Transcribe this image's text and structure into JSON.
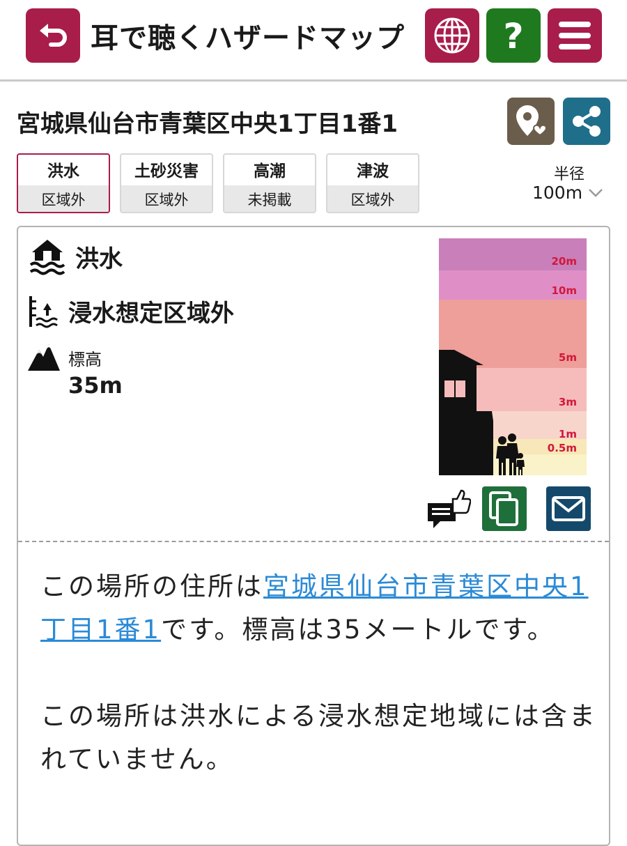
{
  "header": {
    "title": "耳で聴くハザードマップ"
  },
  "location": {
    "address": "宮城県仙台市青葉区中央1丁目1番1"
  },
  "tabs": [
    {
      "label": "洪水",
      "status": "区域外",
      "active": true
    },
    {
      "label": "土砂災害",
      "status": "区域外",
      "active": false
    },
    {
      "label": "高潮",
      "status": "未掲載",
      "active": false
    },
    {
      "label": "津波",
      "status": "区域外",
      "active": false
    }
  ],
  "radius": {
    "label": "半径",
    "value": "100m"
  },
  "detail": {
    "hazard_title": "洪水",
    "status": "浸水想定区域外",
    "elevation_label": "標高",
    "elevation_value": "35m"
  },
  "depth_scale": {
    "levels": [
      "20m",
      "10m",
      "5m",
      "3m",
      "1m",
      "0.5m"
    ]
  },
  "description": {
    "p1_prefix": "この場所の住所は",
    "p1_link": "宮城県仙台市青葉区中央1丁目1番1",
    "p1_suffix": "です。標高は35メートルです。",
    "p2": "この場所は洪水による浸水想定地域には含まれていません。"
  },
  "colors": {
    "brand": "#a81d4a",
    "help": "#1f7a1f",
    "favorite": "#6b5d4c",
    "share": "#1f6f8b",
    "copy": "#1f6f3a",
    "mail": "#14496b",
    "link": "#2b8ad6"
  }
}
